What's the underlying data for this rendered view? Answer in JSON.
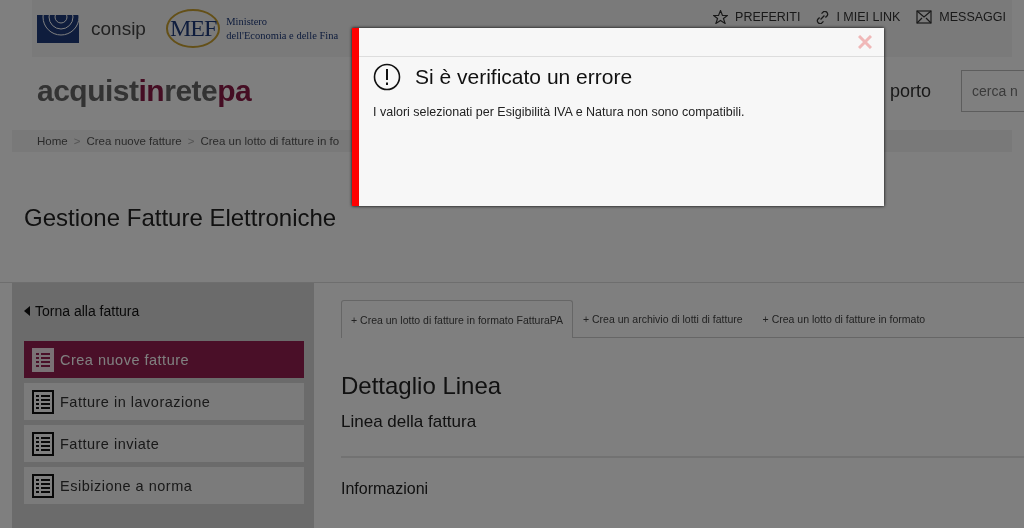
{
  "header": {
    "consip": "consip",
    "mef_mark": "MEF",
    "mef_lines": [
      "Ministero",
      "dell'Economia e delle Fina"
    ],
    "links": [
      {
        "kind": "star",
        "label": "PREFERITI"
      },
      {
        "kind": "link",
        "label": "I MIEI LINK"
      },
      {
        "kind": "mail",
        "label": "MESSAGGI"
      }
    ]
  },
  "brand": {
    "parts": [
      {
        "text": "acquist",
        "accent": false
      },
      {
        "text": "in",
        "accent": true
      },
      {
        "text": "rete",
        "accent": false
      },
      {
        "text": "pa",
        "accent": true
      }
    ]
  },
  "menu_partial": "porto",
  "search": {
    "placeholder": "cerca n"
  },
  "breadcrumb": [
    "Home",
    "Crea nuove fatture",
    "Crea un lotto di fatture in fo"
  ],
  "breadcrumb_separator": ">",
  "page_title": "Gestione Fatture Elettroniche",
  "sidebar": {
    "back": "Torna alla fattura",
    "items": [
      {
        "label": "Crea nuove fatture",
        "selected": true
      },
      {
        "label": "Fatture in lavorazione",
        "selected": false
      },
      {
        "label": "Fatture inviate",
        "selected": false
      },
      {
        "label": "Esibizione a norma",
        "selected": false
      }
    ]
  },
  "tabs": [
    {
      "label": "+ Crea un lotto di fatture in formato FatturaPA",
      "selected": true
    },
    {
      "label": "+ Crea un archivio di lotti di fatture",
      "selected": false
    },
    {
      "label": "+ Crea un lotto di fatture in formato",
      "selected": false
    }
  ],
  "content": {
    "title": "Dettaglio Linea",
    "subtitle": "Linea della fattura",
    "section": "Informazioni"
  },
  "dialog": {
    "title": "Si è verificato un errore",
    "message": "I valori selezionati per Esigibilità IVA e Natura non sono compatibili."
  }
}
